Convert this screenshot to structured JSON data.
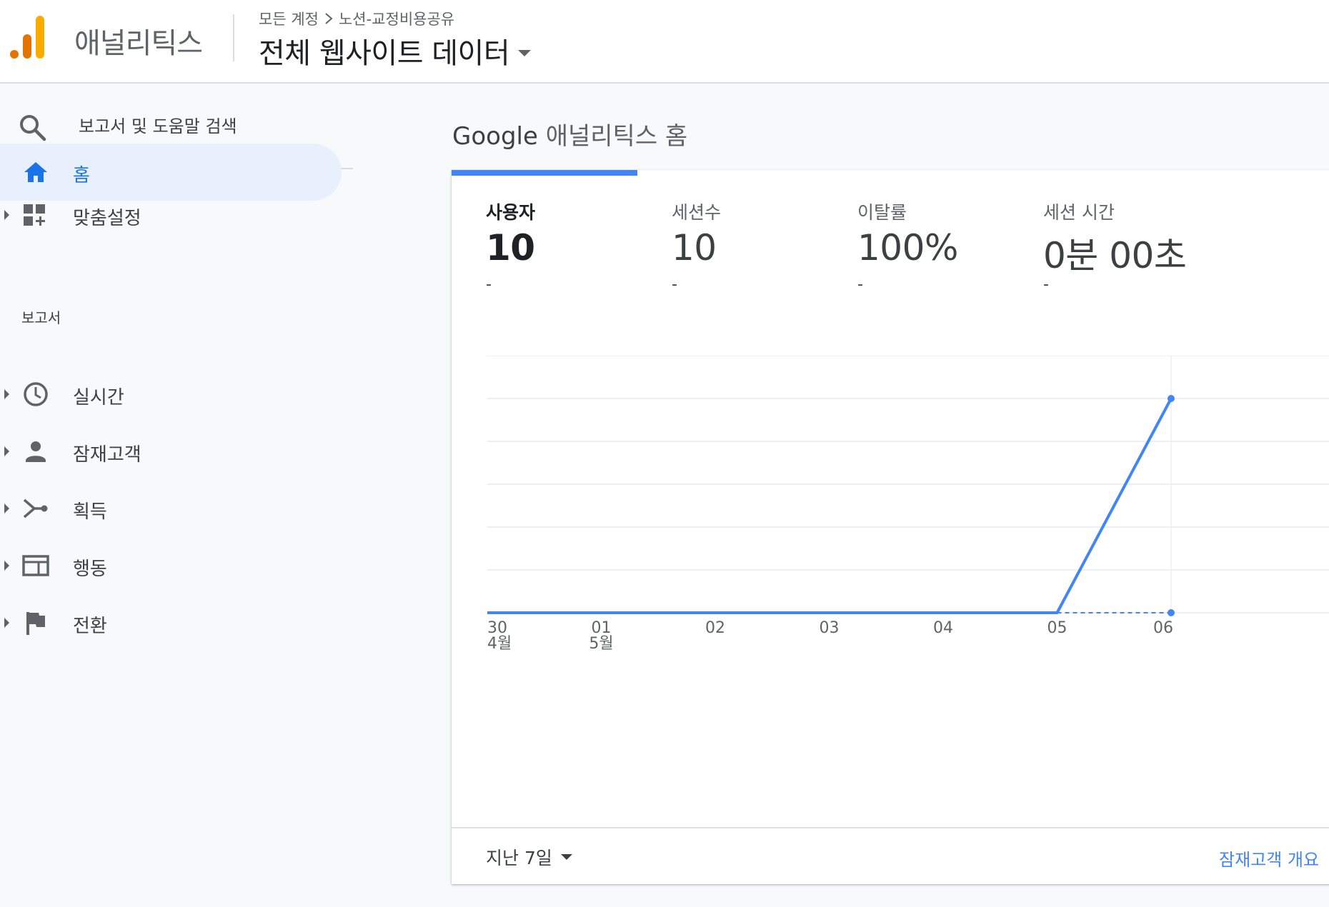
{
  "header": {
    "app_name": "애널리틱스",
    "breadcrumb": {
      "account": "모든 계정",
      "property": "노션-교정비용공유"
    },
    "view_name": "전체 웹사이트 데이터"
  },
  "sidebar": {
    "search_placeholder": "보고서 및 도움말 검색",
    "home_label": "홈",
    "customization_label": "맞춤설정",
    "reports_section": "보고서",
    "items": [
      {
        "label": "실시간",
        "icon": "clock-icon"
      },
      {
        "label": "잠재고객",
        "icon": "person-icon"
      },
      {
        "label": "획득",
        "icon": "acquisition-icon"
      },
      {
        "label": "행동",
        "icon": "behavior-icon"
      },
      {
        "label": "전환",
        "icon": "flag-icon"
      }
    ]
  },
  "main": {
    "heading_google": "Google",
    "heading_rest": "애널리틱스 홈",
    "metrics": [
      {
        "label": "사용자",
        "value": "10",
        "change": "-"
      },
      {
        "label": "세션수",
        "value": "10",
        "change": "-"
      },
      {
        "label": "이탈률",
        "value": "100%",
        "change": "-"
      },
      {
        "label": "세션 시간",
        "value": "0분 00초",
        "change": "-"
      }
    ],
    "date_range": "지난 7일",
    "report_link": "잠재고객 개요"
  },
  "colors": {
    "accent": "#4285f4",
    "active_bg": "#e8f0fe",
    "active_text": "#1a73e8"
  },
  "chart_data": {
    "type": "line",
    "x": [
      "30",
      "01",
      "02",
      "03",
      "04",
      "05",
      "06"
    ],
    "x_month_labels": [
      "4월",
      "5월",
      "",
      "",
      "",
      "",
      ""
    ],
    "series": [
      {
        "values": [
          0,
          0,
          0,
          0,
          0,
          0,
          10
        ]
      }
    ],
    "comparison_dashed": {
      "values": [
        null,
        null,
        null,
        null,
        null,
        0,
        0
      ]
    },
    "ylim": [
      0,
      12
    ],
    "grid": true
  }
}
